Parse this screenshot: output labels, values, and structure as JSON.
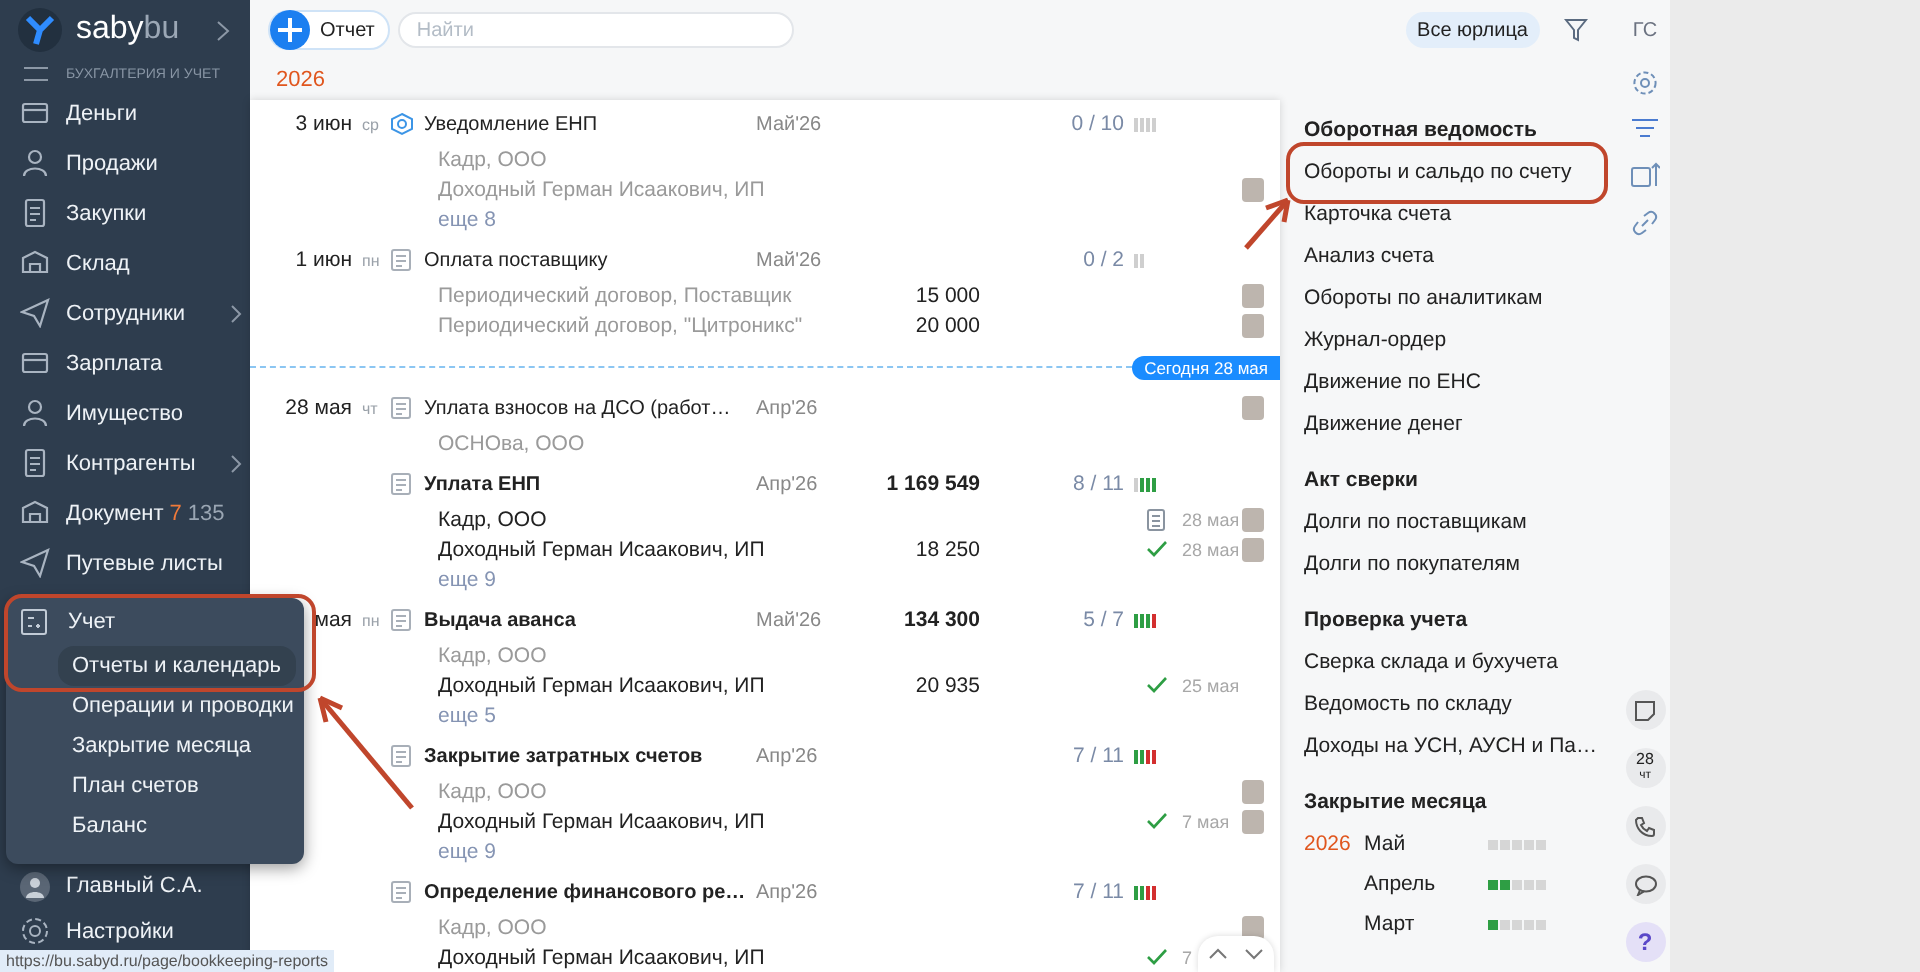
{
  "sidebar": {
    "logo": {
      "brand": "saby",
      "product": "bu"
    },
    "subtitle": "БУХГАЛТЕРИЯ И УЧЕТ",
    "items": [
      {
        "label": "Деньги",
        "has_submenu": false
      },
      {
        "label": "Продажи",
        "has_submenu": false
      },
      {
        "label": "Закупки",
        "has_submenu": false
      },
      {
        "label": "Склад",
        "has_submenu": false
      },
      {
        "label": "Сотрудники",
        "has_submenu": true
      },
      {
        "label": "Зарплата",
        "has_submenu": false
      },
      {
        "label": "Имущество",
        "has_submenu": false
      },
      {
        "label": "Контрагенты",
        "has_submenu": true
      },
      {
        "label": "Документ",
        "has_submenu": false,
        "count_new": "7",
        "count": "135"
      },
      {
        "label": "Путевые листы",
        "has_submenu": false
      }
    ],
    "user": "Главный С.А.",
    "settings": "Настройки"
  },
  "account_menu": {
    "header": "Учет",
    "items": [
      {
        "label": "Отчеты и календарь",
        "selected": true
      },
      {
        "label": "Операции и проводки",
        "selected": false
      },
      {
        "label": "Закрытие месяца",
        "selected": false
      },
      {
        "label": "План счетов",
        "selected": false
      },
      {
        "label": "Баланс",
        "selected": false
      }
    ]
  },
  "toolbar": {
    "add_button": "Отчет",
    "search": {
      "placeholder": "Найти"
    },
    "org_filter": "Все юрлица"
  },
  "year": "2026",
  "tasks": [
    {
      "kind": "task",
      "date": "3 июн",
      "weekday": "ср",
      "title": "Уведомление ЕНП",
      "unread": false,
      "period": "Май'26",
      "progress": "0 / 10",
      "segments": [
        {
          "color": "#cfcfcf"
        },
        {
          "color": "#cfcfcf"
        },
        {
          "color": "#cfcfcf"
        },
        {
          "color": "#cfcfcf"
        }
      ],
      "avatar": false,
      "lines": [
        {
          "name": "Кадр, ООО",
          "muted": true,
          "avatar": false
        },
        {
          "name": "Доходный Герман Исаакович, ИП",
          "muted": true,
          "avatar": true
        }
      ],
      "more": "еще 8"
    },
    {
      "kind": "task",
      "date": "1 июн",
      "weekday": "пн",
      "title": "Оплата поставщику",
      "unread": false,
      "period": "Май'26",
      "progress": "0 / 2",
      "segments": [
        {
          "color": "#cfcfcf"
        },
        {
          "color": "#cfcfcf"
        }
      ],
      "avatar": false,
      "lines": [
        {
          "name": "Периодический договор, Поставщик",
          "muted": true,
          "amount": "15 000",
          "avatar": true
        },
        {
          "name": "Периодический договор, \"Цитроникс\"",
          "muted": true,
          "amount": "20 000",
          "avatar": true
        }
      ]
    },
    {
      "kind": "today_marker",
      "label": "Сегодня 28 мая"
    },
    {
      "kind": "task",
      "date": "28 мая",
      "weekday": "чт",
      "title": "Уплата взносов на ДСО (работ…",
      "unread": false,
      "period": "Апр'26",
      "avatar": true,
      "lines": [
        {
          "name": "ОСНОва, ООО",
          "muted": true,
          "avatar": false
        }
      ]
    },
    {
      "kind": "task",
      "title": "Уплата ЕНП",
      "unread": true,
      "period": "Апр'26",
      "amount": "1 169 549",
      "progress": "8 / 11",
      "segments": [
        {
          "color": "#cfcfcf"
        },
        {
          "color": "#2e9e44"
        },
        {
          "color": "#2e9e44"
        },
        {
          "color": "#2e9e44"
        }
      ],
      "avatar": false,
      "lines": [
        {
          "name": "Кадр, ООО",
          "muted": false,
          "kind": "doc",
          "status_date": "28 мая",
          "avatar": true
        },
        {
          "name": "Доходный Герман Исаакович, ИП",
          "muted": false,
          "amount": "18 250",
          "kind": "check",
          "status_date": "28 мая",
          "avatar": true
        }
      ],
      "more": "еще 9"
    },
    {
      "kind": "task",
      "date": "мая",
      "weekday": "пн",
      "title": "Выдача аванса",
      "unread": true,
      "period": "Май'26",
      "amount": "134 300",
      "progress": "5 / 7",
      "segments": [
        {
          "color": "#2e9e44"
        },
        {
          "color": "#2e9e44"
        },
        {
          "color": "#2e9e44"
        },
        {
          "color": "#d32f2f"
        }
      ],
      "avatar": false,
      "lines": [
        {
          "name": "Кадр, ООО",
          "muted": true,
          "avatar": false
        },
        {
          "name": "Доходный Герман Исаакович, ИП",
          "muted": false,
          "amount": "20 935",
          "kind": "check",
          "status_date": "25 мая",
          "avatar": false
        }
      ],
      "more": "еще 5"
    },
    {
      "kind": "task",
      "title": "Закрытие затратных счетов",
      "unread": true,
      "period": "Апр'26",
      "progress": "7 / 11",
      "segments": [
        {
          "color": "#2e9e44"
        },
        {
          "color": "#2e9e44"
        },
        {
          "color": "#d32f2f"
        },
        {
          "color": "#d32f2f"
        }
      ],
      "avatar": false,
      "lines": [
        {
          "name": "Кадр, ООО",
          "muted": true,
          "avatar": true
        },
        {
          "name": "Доходный Герман Исаакович, ИП",
          "muted": false,
          "kind": "check",
          "status_date": "7 мая",
          "avatar": true
        }
      ],
      "more": "еще 9"
    },
    {
      "kind": "task",
      "title": "Определение финансового ре…",
      "unread": true,
      "period": "Апр'26",
      "progress": "7 / 11",
      "segments": [
        {
          "color": "#2e9e44"
        },
        {
          "color": "#2e9e44"
        },
        {
          "color": "#d32f2f"
        },
        {
          "color": "#d32f2f"
        }
      ],
      "avatar": false,
      "lines": [
        {
          "name": "Кадр, ООО",
          "muted": true,
          "avatar": true
        },
        {
          "name": "Доходный Герман Исаакович, ИП",
          "muted": false,
          "kind": "check",
          "status_date": "7",
          "avatar": false
        }
      ]
    }
  ],
  "reports": {
    "sections": [
      {
        "title": "Оборотная ведомость",
        "items": [
          "Обороты и сальдо по счету",
          "Карточка счета",
          "Анализ счета",
          "Обороты по аналитикам",
          "Журнал-ордер",
          "Движение по ЕНС",
          "Движение денег"
        ]
      },
      {
        "title": "Акт сверки",
        "items": [
          "Долги по поставщикам",
          "Долги по покупателям"
        ]
      },
      {
        "title": "Проверка учета",
        "items": [
          "Сверка склада и бухучета",
          "Ведомость по складу",
          "Доходы на УСН, АУСН и Па…"
        ]
      }
    ],
    "month_closing": {
      "title": "Закрытие месяца",
      "year": "2026",
      "months": [
        {
          "name": "Май",
          "segments": [
            {
              "color": "#d6d6d6"
            },
            {
              "color": "#d6d6d6"
            },
            {
              "color": "#d6d6d6"
            },
            {
              "color": "#d6d6d6"
            },
            {
              "color": "#d6d6d6"
            }
          ]
        },
        {
          "name": "Апрель",
          "segments": [
            {
              "color": "#2e9e44"
            },
            {
              "color": "#2e9e44"
            },
            {
              "color": "#d6d6d6"
            },
            {
              "color": "#d6d6d6"
            },
            {
              "color": "#d6d6d6"
            }
          ]
        },
        {
          "name": "Март",
          "segments": [
            {
              "color": "#2e9e44"
            },
            {
              "color": "#d6d6d6"
            },
            {
              "color": "#d6d6d6"
            },
            {
              "color": "#d6d6d6"
            },
            {
              "color": "#d6d6d6"
            }
          ]
        }
      ]
    }
  },
  "tools": {
    "initials": "ГС",
    "calendar_day": "28",
    "calendar_weekday": "чт",
    "help": "?"
  },
  "status_url": "https://bu.sabyd.ru/page/bookkeeping-reports"
}
